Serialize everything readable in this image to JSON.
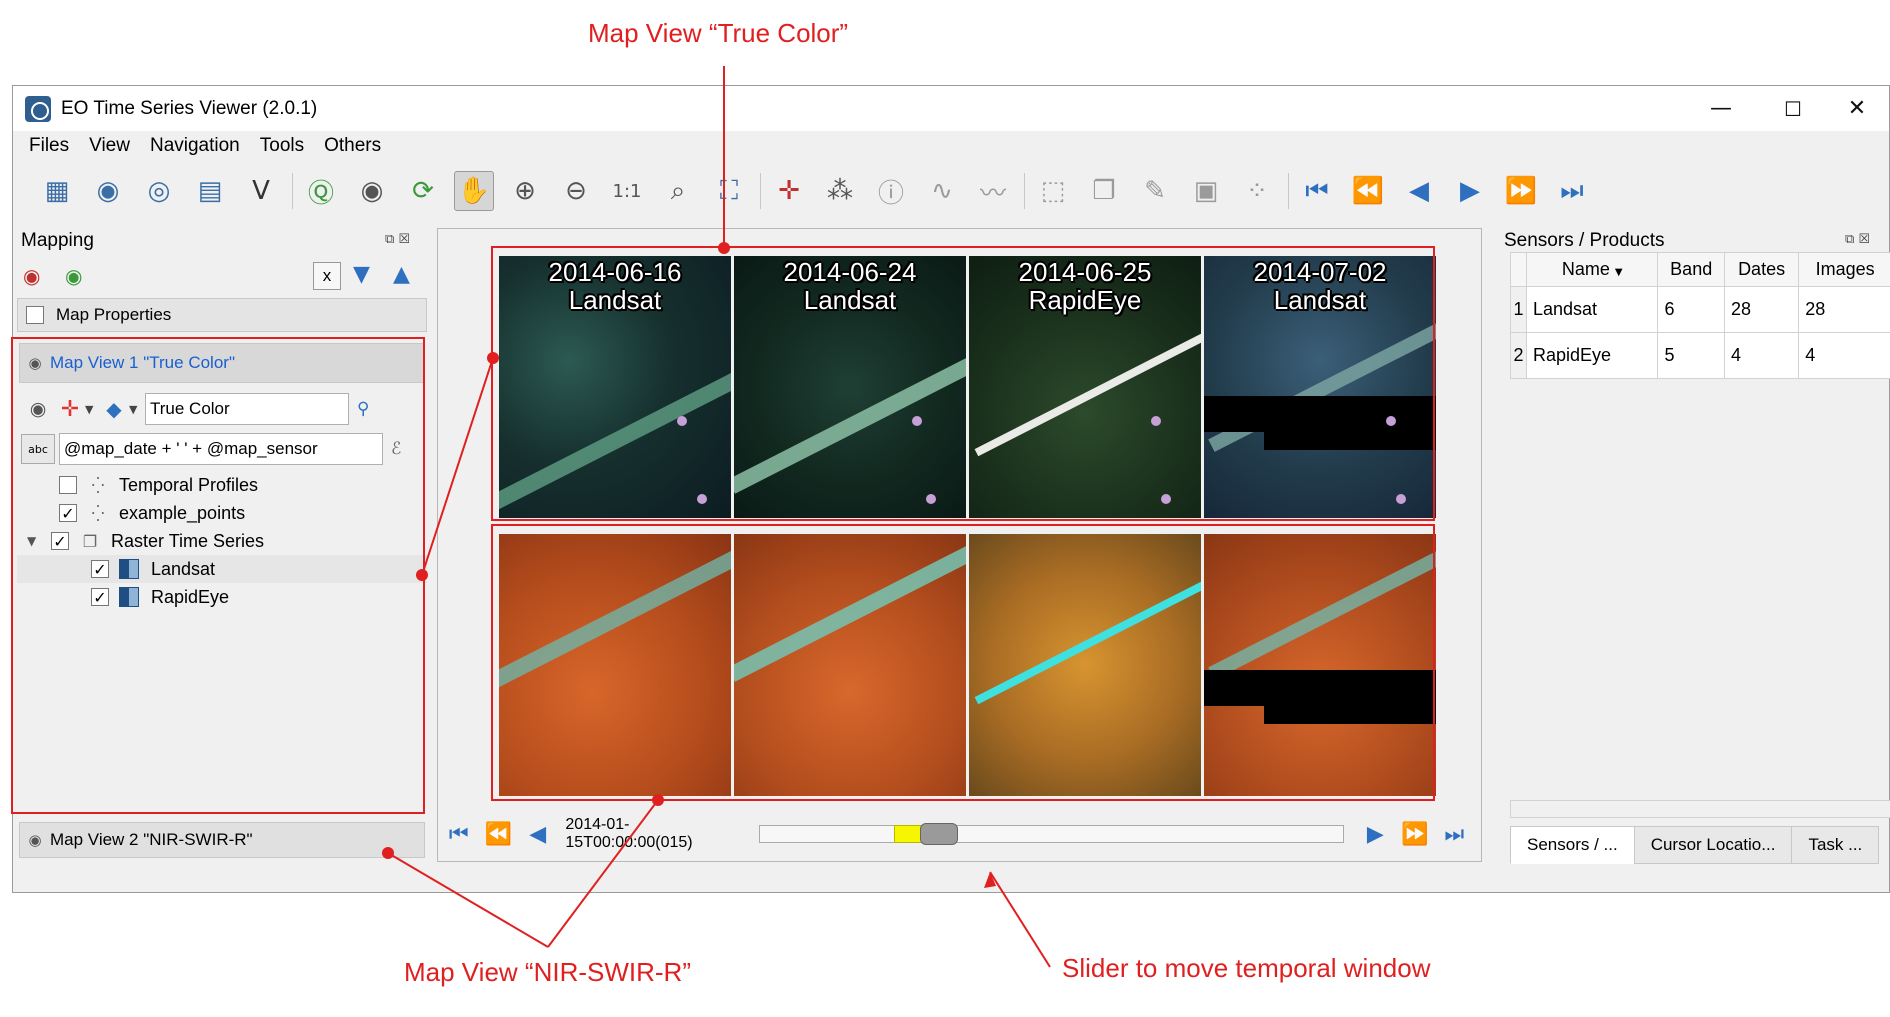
{
  "annotations": {
    "true_color": "Map View “True Color”",
    "nir_swir_r": "Map View “NIR-SWIR-R”",
    "slider": "Slider to move temporal window"
  },
  "window": {
    "title": "EO Time Series Viewer (2.0.1)",
    "minimize": "—",
    "maximize": "☐",
    "close": "✕"
  },
  "menu": [
    "Files",
    "View",
    "Navigation",
    "Tools",
    "Others"
  ],
  "toolbar_icons": [
    "add-raster-icon",
    "add-sensor-icon",
    "remove-sensor-icon",
    "load-series-icon",
    "add-vector-icon",
    "qgis-sync-icon",
    "add-map-view-icon",
    "refresh-icon",
    "pan-icon",
    "zoom-in-icon",
    "zoom-out-icon",
    "zoom-1to1-icon",
    "zoom-pixel-icon",
    "zoom-full-icon",
    "select-location-icon",
    "spectral-profile-icon",
    "identify-icon",
    "temporal-profile-icon",
    "profile-line-icon",
    "select-feature-icon",
    "copy-features-icon",
    "edit-icon",
    "save-icon",
    "add-points-icon",
    "nav-first-icon",
    "nav-prev-fast-icon",
    "nav-prev-icon",
    "nav-next-icon",
    "nav-next-fast-icon",
    "nav-last-icon"
  ],
  "mapping_panel": {
    "title": "Mapping",
    "clear_label": "x",
    "map_properties": "Map Properties",
    "map_view_1": "Map View 1 \"True Color\"",
    "renderer_value": "True Color",
    "label_expression": "@map_date + ' ' + @map_sensor",
    "abc_badge": "abc",
    "layers": [
      {
        "name": "Temporal Profiles",
        "checked": false
      },
      {
        "name": "example_points",
        "checked": true
      },
      {
        "name": "Raster Time Series",
        "checked": true
      },
      {
        "name": "Landsat",
        "checked": true
      },
      {
        "name": "RapidEye",
        "checked": true
      }
    ],
    "map_view_2": "Map View 2 \"NIR-SWIR-R\""
  },
  "tiles": [
    {
      "date": "2014-06-16",
      "sensor": "Landsat"
    },
    {
      "date": "2014-06-24",
      "sensor": "Landsat"
    },
    {
      "date": "2014-06-25",
      "sensor": "RapidEye"
    },
    {
      "date": "2014-07-02",
      "sensor": "Landsat"
    }
  ],
  "timeline": {
    "timestamp": "2014-01-15T00:00:00(015)",
    "position": 0.25
  },
  "sensors_panel": {
    "title": "Sensors / Products",
    "columns": [
      "Name",
      "Band",
      "Dates",
      "Images"
    ],
    "rows": [
      {
        "num": "1",
        "name": "Landsat",
        "band": "6",
        "dates": "28",
        "images": "28"
      },
      {
        "num": "2",
        "name": "RapidEye",
        "band": "5",
        "dates": "4",
        "images": "4"
      }
    ],
    "tabs": [
      "Sensors / ...",
      "Cursor Locatio...",
      "Task ..."
    ]
  },
  "colors": {
    "annotation_red": "#e02020",
    "slider_yellow": "#f6f600",
    "link_blue": "#1a5fd0"
  }
}
